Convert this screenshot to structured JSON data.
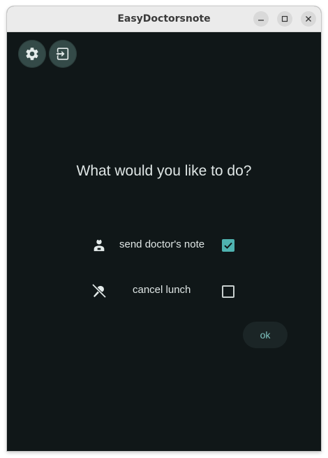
{
  "window": {
    "title": "EasyDoctorsnote"
  },
  "toolbar": {
    "settings_icon": "gear-icon",
    "logout_icon": "exit-icon"
  },
  "main": {
    "question": "What would you like to do?",
    "options": [
      {
        "label": "send doctor's note",
        "icon": "doctor-icon",
        "checked": true
      },
      {
        "label": "cancel lunch",
        "icon": "no-food-icon",
        "checked": false
      }
    ],
    "ok_label": "ok"
  },
  "colors": {
    "background": "#101718",
    "accent": "#4fb3b0",
    "button_bg": "#344a48",
    "text": "#dfe6e5"
  }
}
